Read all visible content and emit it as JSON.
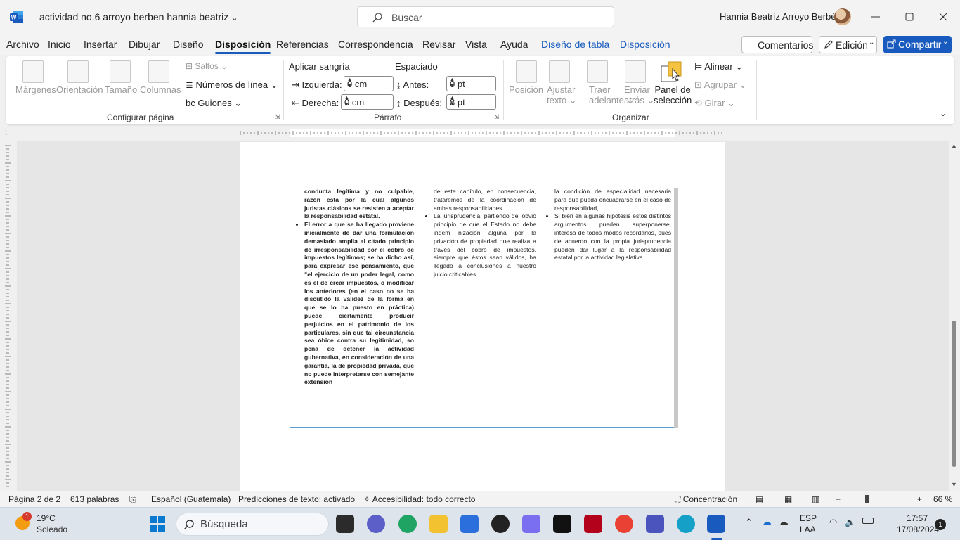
{
  "titlebar": {
    "doc_title": "actividad no.6 arroyo berben hannia beatriz",
    "search_placeholder": "Buscar",
    "user_name": "Hannia Beatríz Arroyo  Berbén"
  },
  "tabs": [
    {
      "label": "Archivo"
    },
    {
      "label": "Inicio"
    },
    {
      "label": "Insertar"
    },
    {
      "label": "Dibujar"
    },
    {
      "label": "Diseño"
    },
    {
      "label": "Disposición"
    },
    {
      "label": "Referencias"
    },
    {
      "label": "Correspondencia"
    },
    {
      "label": "Revisar"
    },
    {
      "label": "Vista"
    },
    {
      "label": "Ayuda"
    },
    {
      "label": "Diseño de tabla"
    },
    {
      "label": "Disposición"
    }
  ],
  "header_buttons": {
    "comments": "Comentarios",
    "edit": "Edición",
    "share": "Compartir"
  },
  "ribbon": {
    "page_setup": {
      "margins": "Márgenes",
      "orientation": "Orientación",
      "size": "Tamaño",
      "columns": "Columnas",
      "breaks": "Saltos",
      "line_numbers": "Números de línea",
      "hyphenation": "Guiones",
      "group": "Configurar página"
    },
    "paragraph": {
      "indent_header": "Aplicar sangría",
      "spacing_header": "Espaciado",
      "left_label": "Izquierda:",
      "left_value": "0 cm",
      "right_label": "Derecha:",
      "right_value": "0 cm",
      "before_label": "Antes:",
      "before_value": "0 pt",
      "after_label": "Después:",
      "after_value": "8 pt",
      "group": "Párrafo"
    },
    "arrange": {
      "position": "Posición",
      "wrap_text_1": "Ajustar",
      "wrap_text_2": "texto",
      "bring_forward_1": "Traer",
      "bring_forward_2": "adelante",
      "send_backward_1": "Enviar",
      "send_backward_2": "atrás",
      "selection_pane_1": "Panel de",
      "selection_pane_2": "selección",
      "align": "Alinear",
      "group_btn": "Agrupar",
      "rotate": "Girar",
      "group": "Organizar"
    }
  },
  "document": {
    "col1_intro": "conducta legítima y no culpable, razón esta por la cual algunos juristas clásicos se resisten a aceptar la responsabilidad estatal.",
    "col1_bullet": "El error a que se ha llegado proviene inicialmente de dar una formulación demasiado amplia al citado principio de irresponsabilidad por el cobro de impuestos legítimos; se ha dicho así, para expresar ese pensamiento, que “el ejercicio de un poder legal, como es el de crear impuestos, o modificar los anteriores (en el caso no se ha discutido la validez de la forma en que se lo ha puesto en práctica) puede ciertamente producir perjuicios en el patrimonio de los particulares, sin que tal circunstancia sea óbice contra su legitimidad, so pena de detener la actividad gubernativa, en consideración de una garantía, la de propiedad privada, que no puede interpretarse con semejante extensión",
    "col2_intro": "de este capítulo, en consecuencia, trataremos de la coordinación de ambas responsabilidades.",
    "col2_bullet": "La jurisprudencia, partiendo del obvio principio de que el Estado no debe indem nización alguna por la privación de propiedad que realiza a través del cobro de impuestos, siempre que éstos sean válidos, ha llegado a conclusiones a nuestro juicio criticables.",
    "col3_intro": "la condición de especialidad necesaria para que pueda encuadrarse en el caso de responsabilidad,",
    "col3_bullet": "Si bien en algunas hipótesis estos distintos argumentos pueden superponerse, interesa de todos modos recordarlos, pues de acuerdo con la propia jurisprudencia pueden dar lugar a la responsabilidad estatal por la actividad legislativa"
  },
  "statusbar": {
    "page": "Página 2 de 2",
    "words": "613 palabras",
    "language": "Español (Guatemala)",
    "predictions": "Predicciones de texto: activado",
    "accessibility": "Accesibilidad: todo correcto",
    "focus": "Concentración",
    "zoom": "66 %"
  },
  "taskbar": {
    "weather_temp": "19°C",
    "weather_desc": "Soleado",
    "weather_badge": "1",
    "search": "Búsqueda",
    "lang_1": "ESP",
    "lang_2": "LAA",
    "time": "17:57",
    "date": "17/08/2024",
    "notif": "1"
  },
  "colors": {
    "accent": "#185abd",
    "table_border": "#5aa0d6"
  }
}
